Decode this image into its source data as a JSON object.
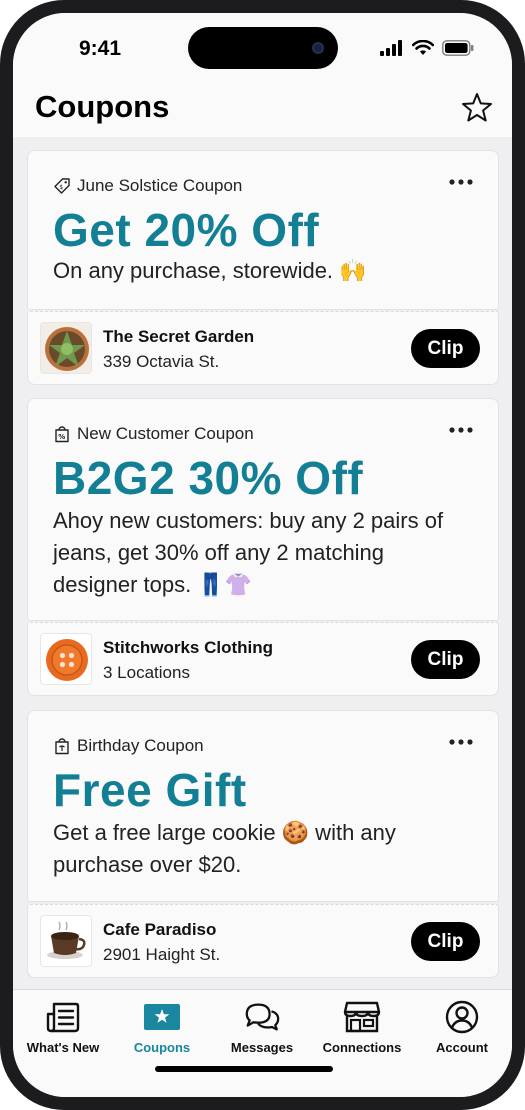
{
  "status_bar": {
    "time": "9:41"
  },
  "header": {
    "title": "Coupons"
  },
  "colors": {
    "accent": "#137f94",
    "active_tab": "#1a86a0",
    "clip_bg": "#000000"
  },
  "coupons": [
    {
      "type_label": "June Solstice Coupon",
      "type_icon": "tag-icon",
      "offer": "Get 20% Off",
      "description": "On any purchase, storewide. 🙌",
      "merchant_name": "The Secret Garden",
      "merchant_sub": "339 Octavia St.",
      "clip_label": "Clip"
    },
    {
      "type_label": "New Customer Coupon",
      "type_icon": "shopping-bag-percent-icon",
      "offer": "B2G2 30% Off",
      "description": "Ahoy new customers: buy any 2 pairs of jeans, get 30% off any 2 matching designer tops. 👖👚",
      "merchant_name": "Stitchworks Clothing",
      "merchant_sub": "3 Locations",
      "clip_label": "Clip"
    },
    {
      "type_label": "Birthday Coupon",
      "type_icon": "gift-bag-icon",
      "offer": "Free Gift",
      "description": "Get a free large cookie 🍪 with any purchase over $20.",
      "merchant_name": "Cafe Paradiso",
      "merchant_sub": "2901 Haight St.",
      "clip_label": "Clip"
    }
  ],
  "tabs": [
    {
      "label": "What's New",
      "icon": "news-icon",
      "active": false
    },
    {
      "label": "Coupons",
      "icon": "coupon-star-icon",
      "active": true
    },
    {
      "label": "Messages",
      "icon": "chat-bubbles-icon",
      "active": false
    },
    {
      "label": "Connections",
      "icon": "storefront-icon",
      "active": false
    },
    {
      "label": "Account",
      "icon": "user-circle-icon",
      "active": false
    }
  ]
}
